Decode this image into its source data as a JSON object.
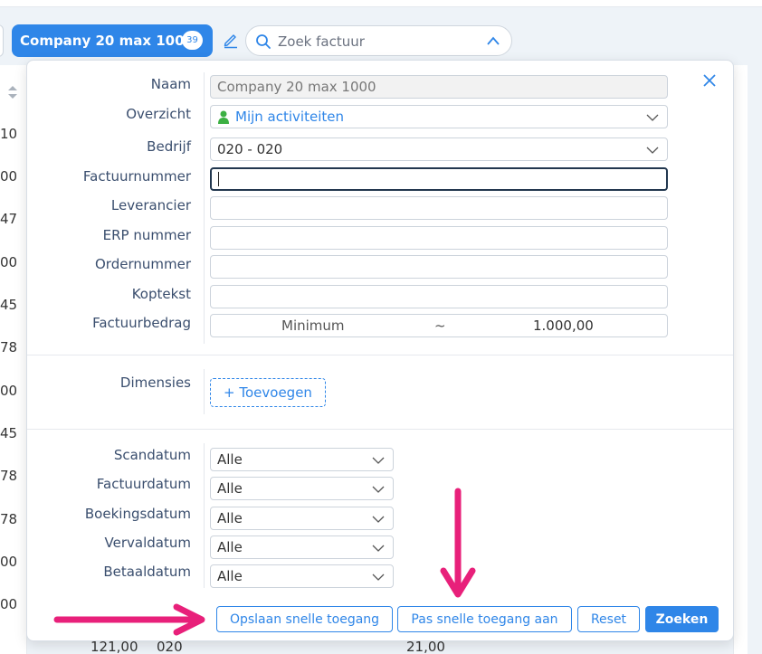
{
  "toolbar": {
    "chip_label": "Company 20 max 1000",
    "chip_count": "39",
    "search_placeholder": "Zoek factuur"
  },
  "background_table": {
    "cells": [
      "10",
      "00",
      "47",
      "00",
      "45",
      "78",
      "00",
      "45",
      "78",
      "78",
      "00",
      "00",
      "00"
    ],
    "bottom_row": {
      "amount": "121,00",
      "code": "020",
      "vat": "21,00"
    }
  },
  "form": {
    "naam": {
      "label": "Naam",
      "value": "Company 20 max 1000"
    },
    "overzicht": {
      "label": "Overzicht",
      "value": "Mijn activiteiten"
    },
    "bedrijf": {
      "label": "Bedrijf",
      "value": "020 - 020"
    },
    "factuurnummer": {
      "label": "Factuurnummer",
      "value": ""
    },
    "leverancier": {
      "label": "Leverancier",
      "value": ""
    },
    "erp_nummer": {
      "label": "ERP nummer",
      "value": ""
    },
    "ordernummer": {
      "label": "Ordernummer",
      "value": ""
    },
    "koptekst": {
      "label": "Koptekst",
      "value": ""
    },
    "factuurbedrag": {
      "label": "Factuurbedrag",
      "min_placeholder": "Minimum",
      "separator": "~",
      "max_value": "1.000,00"
    },
    "dimensies": {
      "label": "Dimensies",
      "add_label": "+ Toevoegen"
    },
    "dates": [
      {
        "label": "Scandatum",
        "value": "Alle"
      },
      {
        "label": "Factuurdatum",
        "value": "Alle"
      },
      {
        "label": "Boekingsdatum",
        "value": "Alle"
      },
      {
        "label": "Vervaldatum",
        "value": "Alle"
      },
      {
        "label": "Betaaldatum",
        "value": "Alle"
      }
    ]
  },
  "buttons": {
    "save_quick": "Opslaan snelle toegang",
    "edit_quick": "Pas snelle toegang aan",
    "reset": "Reset",
    "search": "Zoeken"
  },
  "colors": {
    "accent": "#2f86e8",
    "annotation": "#e8207a"
  }
}
